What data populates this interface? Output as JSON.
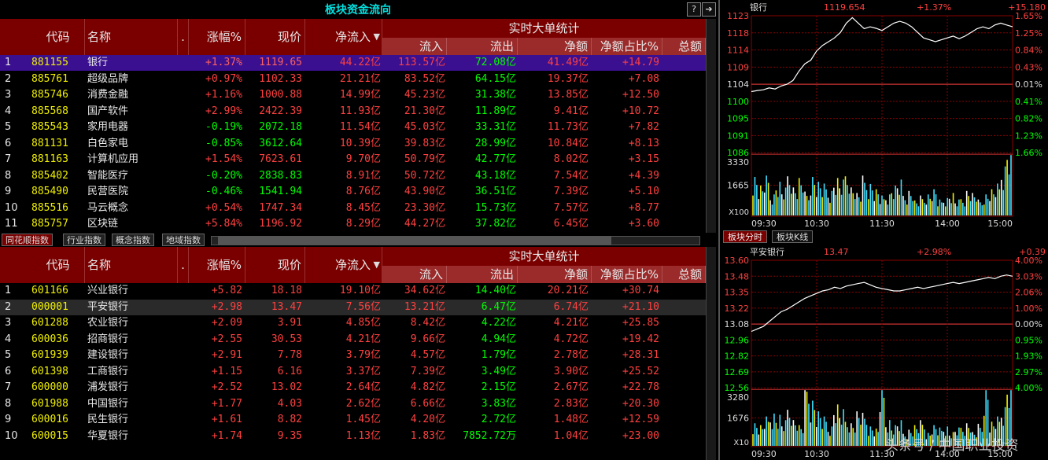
{
  "title": "板块资金流向",
  "help_label": "?",
  "headers": {
    "seq": "",
    "code": "代码",
    "name": "名称",
    "dot": ".",
    "change": "涨幅%",
    "price": "现价",
    "netin": "净流入",
    "bigorder": "实时大单统计",
    "inflow": "流入",
    "outflow": "流出",
    "net": "净额",
    "netratio": "净额占比%",
    "total": "总额"
  },
  "sector_rows": [
    {
      "no": "1",
      "code": "881155",
      "name": "银行",
      "change": "+1.37%",
      "price": "1119.65",
      "netin": "44.22亿",
      "inflow": "113.57亿",
      "outflow": "72.08亿",
      "net": "41.49亿",
      "ratio": "+14.79",
      "up": true
    },
    {
      "no": "2",
      "code": "885761",
      "name": "超级品牌",
      "change": "+0.97%",
      "price": "1102.33",
      "netin": "21.21亿",
      "inflow": "83.52亿",
      "outflow": "64.15亿",
      "net": "19.37亿",
      "ratio": "+7.08",
      "up": true
    },
    {
      "no": "3",
      "code": "885746",
      "name": "消费金融",
      "change": "+1.16%",
      "price": "1000.88",
      "netin": "14.99亿",
      "inflow": "45.23亿",
      "outflow": "31.38亿",
      "net": "13.85亿",
      "ratio": "+12.50",
      "up": true
    },
    {
      "no": "4",
      "code": "885568",
      "name": "国产软件",
      "change": "+2.99%",
      "price": "2422.39",
      "netin": "11.93亿",
      "inflow": "21.30亿",
      "outflow": "11.89亿",
      "net": "9.41亿",
      "ratio": "+10.72",
      "up": true
    },
    {
      "no": "5",
      "code": "885543",
      "name": "家用电器",
      "change": "-0.19%",
      "price": "2072.18",
      "netin": "11.54亿",
      "inflow": "45.03亿",
      "outflow": "33.31亿",
      "net": "11.73亿",
      "ratio": "+7.82",
      "up": false
    },
    {
      "no": "6",
      "code": "881131",
      "name": "白色家电",
      "change": "-0.85%",
      "price": "3612.64",
      "netin": "10.39亿",
      "inflow": "39.83亿",
      "outflow": "28.99亿",
      "net": "10.84亿",
      "ratio": "+8.13",
      "up": false
    },
    {
      "no": "7",
      "code": "881163",
      "name": "计算机应用",
      "change": "+1.54%",
      "price": "7623.61",
      "netin": "9.70亿",
      "inflow": "50.79亿",
      "outflow": "42.77亿",
      "net": "8.02亿",
      "ratio": "+3.15",
      "up": true
    },
    {
      "no": "8",
      "code": "885402",
      "name": "智能医疗",
      "change": "-0.20%",
      "price": "2838.83",
      "netin": "8.91亿",
      "inflow": "50.72亿",
      "outflow": "43.18亿",
      "net": "7.54亿",
      "ratio": "+4.39",
      "up": false
    },
    {
      "no": "9",
      "code": "885490",
      "name": "民营医院",
      "change": "-0.46%",
      "price": "1541.94",
      "netin": "8.76亿",
      "inflow": "43.90亿",
      "outflow": "36.51亿",
      "net": "7.39亿",
      "ratio": "+5.10",
      "up": false
    },
    {
      "no": "10",
      "code": "885516",
      "name": "马云概念",
      "change": "+0.54%",
      "price": "1747.34",
      "netin": "8.45亿",
      "inflow": "23.30亿",
      "outflow": "15.73亿",
      "net": "7.57亿",
      "ratio": "+8.77",
      "up": true
    },
    {
      "no": "11",
      "code": "885757",
      "name": "区块链",
      "change": "+5.84%",
      "price": "1196.92",
      "netin": "8.29亿",
      "inflow": "44.27亿",
      "outflow": "37.82亿",
      "net": "6.45亿",
      "ratio": "+3.60",
      "up": true
    }
  ],
  "tabs": [
    "同花顺指数",
    "行业指数",
    "概念指数",
    "地域指数"
  ],
  "stock_rows": [
    {
      "no": "1",
      "code": "601166",
      "name": "兴业银行",
      "change": "+5.82",
      "price": "18.18",
      "netin": "19.10亿",
      "inflow": "34.62亿",
      "outflow": "14.40亿",
      "net": "20.21亿",
      "ratio": "+30.74"
    },
    {
      "no": "2",
      "code": "000001",
      "name": "平安银行",
      "change": "+2.98",
      "price": "13.47",
      "netin": "7.56亿",
      "inflow": "13.21亿",
      "outflow": "6.47亿",
      "net": "6.74亿",
      "ratio": "+21.10"
    },
    {
      "no": "3",
      "code": "601288",
      "name": "农业银行",
      "change": "+2.09",
      "price": "3.91",
      "netin": "4.85亿",
      "inflow": "8.42亿",
      "outflow": "4.22亿",
      "net": "4.21亿",
      "ratio": "+25.85"
    },
    {
      "no": "4",
      "code": "600036",
      "name": "招商银行",
      "change": "+2.55",
      "price": "30.53",
      "netin": "4.21亿",
      "inflow": "9.66亿",
      "outflow": "4.94亿",
      "net": "4.72亿",
      "ratio": "+19.42"
    },
    {
      "no": "5",
      "code": "601939",
      "name": "建设银行",
      "change": "+2.91",
      "price": "7.78",
      "netin": "3.79亿",
      "inflow": "4.57亿",
      "outflow": "1.79亿",
      "net": "2.78亿",
      "ratio": "+28.31"
    },
    {
      "no": "6",
      "code": "601398",
      "name": "工商银行",
      "change": "+1.15",
      "price": "6.16",
      "netin": "3.37亿",
      "inflow": "7.39亿",
      "outflow": "3.49亿",
      "net": "3.90亿",
      "ratio": "+25.52"
    },
    {
      "no": "7",
      "code": "600000",
      "name": "浦发银行",
      "change": "+2.52",
      "price": "13.02",
      "netin": "2.64亿",
      "inflow": "4.82亿",
      "outflow": "2.15亿",
      "net": "2.67亿",
      "ratio": "+22.78"
    },
    {
      "no": "8",
      "code": "601988",
      "name": "中国银行",
      "change": "+1.77",
      "price": "4.03",
      "netin": "2.62亿",
      "inflow": "6.66亿",
      "outflow": "3.83亿",
      "net": "2.83亿",
      "ratio": "+20.30"
    },
    {
      "no": "9",
      "code": "600016",
      "name": "民生银行",
      "change": "+1.61",
      "price": "8.82",
      "netin": "1.45亿",
      "inflow": "4.20亿",
      "outflow": "2.72亿",
      "net": "1.48亿",
      "ratio": "+12.59"
    },
    {
      "no": "10",
      "code": "600015",
      "name": "华夏银行",
      "change": "+1.74",
      "price": "9.35",
      "netin": "1.13亿",
      "inflow": "1.83亿",
      "outflow": "7852.72万",
      "net": "1.04亿",
      "ratio": "+23.00"
    }
  ],
  "chart_data": [
    {
      "type": "line",
      "name_label": "银行",
      "price_label": "1119.654",
      "pct_label": "+1.37%",
      "change_label": "+15.180",
      "y_left": [
        "1123",
        "1118",
        "1114",
        "1109",
        "1104",
        "1100",
        "1095",
        "1091",
        "1086"
      ],
      "y_right": [
        "1.65%",
        "1.25%",
        "0.84%",
        "0.43%",
        "0.01%",
        "0.41%",
        "0.82%",
        "1.23%",
        "1.66%"
      ],
      "vol_labels": [
        "3330",
        "1665",
        "X100"
      ],
      "x_labels": [
        "09:30",
        "10:30",
        "11:30",
        "14:00",
        "15:00"
      ],
      "ylim": [
        1086,
        1123
      ],
      "base": 1104,
      "series_y": [
        1102.5,
        1102.8,
        1103.0,
        1103.5,
        1103.2,
        1104.0,
        1104.5,
        1105.5,
        1108.0,
        1110.0,
        1111.0,
        1113.5,
        1115.0,
        1116.0,
        1117.0,
        1118.5,
        1121.0,
        1122.5,
        1121.0,
        1119.5,
        1120.0,
        1119.6,
        1119.0,
        1120.0,
        1121.0,
        1121.5,
        1121.0,
        1120.0,
        1118.5,
        1117.0,
        1116.5,
        1116.0,
        1116.5,
        1117.0,
        1117.5,
        1116.8,
        1117.5,
        1118.5,
        1119.5,
        1120.0,
        1119.5,
        1120.5,
        1121.0,
        1120.5,
        1120.0
      ],
      "volumes": [
        0.55,
        0.4,
        0.5,
        0.3,
        0.45,
        0.35,
        0.6,
        0.4,
        0.5,
        0.3,
        0.55,
        0.45,
        0.4,
        0.35,
        0.5,
        0.45,
        0.6,
        0.4,
        0.3,
        0.5,
        0.45,
        0.35,
        0.25,
        0.3,
        0.4,
        0.45,
        0.3,
        0.35,
        0.2,
        0.25,
        0.3,
        0.35,
        0.2,
        0.25,
        0.3,
        0.2,
        0.25,
        0.35,
        0.3,
        0.2,
        0.3,
        0.35,
        0.4,
        0.7,
        1.0
      ]
    },
    {
      "type": "line",
      "name_label": "平安银行",
      "price_label": "13.47",
      "pct_label": "+2.98%",
      "change_label": "+0.39",
      "y_left": [
        "13.60",
        "13.48",
        "13.35",
        "13.22",
        "13.08",
        "12.96",
        "12.82",
        "12.69",
        "12.56"
      ],
      "y_right": [
        "4.00%",
        "3.03%",
        "2.06%",
        "1.00%",
        "0.00%",
        "0.95%",
        "1.93%",
        "2.97%",
        "4.00%"
      ],
      "vol_labels": [
        "3280",
        "1676",
        "X10"
      ],
      "x_labels": [
        "09:30",
        "10:30",
        "11:30",
        "14:00",
        "15:00"
      ],
      "ylim": [
        12.56,
        13.6
      ],
      "base": 13.08,
      "series_y": [
        13.02,
        13.04,
        13.06,
        13.1,
        13.14,
        13.18,
        13.2,
        13.23,
        13.26,
        13.29,
        13.31,
        13.33,
        13.35,
        13.36,
        13.38,
        13.37,
        13.39,
        13.4,
        13.41,
        13.42,
        13.4,
        13.38,
        13.37,
        13.36,
        13.35,
        13.35,
        13.36,
        13.37,
        13.38,
        13.37,
        13.38,
        13.39,
        13.4,
        13.41,
        13.42,
        13.41,
        13.42,
        13.43,
        13.44,
        13.45,
        13.46,
        13.45,
        13.47,
        13.48,
        13.47
      ],
      "volumes": [
        0.35,
        0.3,
        0.4,
        0.5,
        0.45,
        0.35,
        0.6,
        0.4,
        0.3,
        0.9,
        0.7,
        0.5,
        0.4,
        0.3,
        0.6,
        0.5,
        0.4,
        0.35,
        0.5,
        0.45,
        0.3,
        0.25,
        0.8,
        0.4,
        0.3,
        0.35,
        0.2,
        0.25,
        0.3,
        0.35,
        0.2,
        0.3,
        0.25,
        0.3,
        0.2,
        0.25,
        0.3,
        0.35,
        0.2,
        0.3,
        0.9,
        0.35,
        0.4,
        0.6,
        1.0
      ]
    }
  ],
  "right_tabs": [
    "板块分时",
    "板块K线"
  ],
  "watermark": "头条号 / 中国职业投资"
}
